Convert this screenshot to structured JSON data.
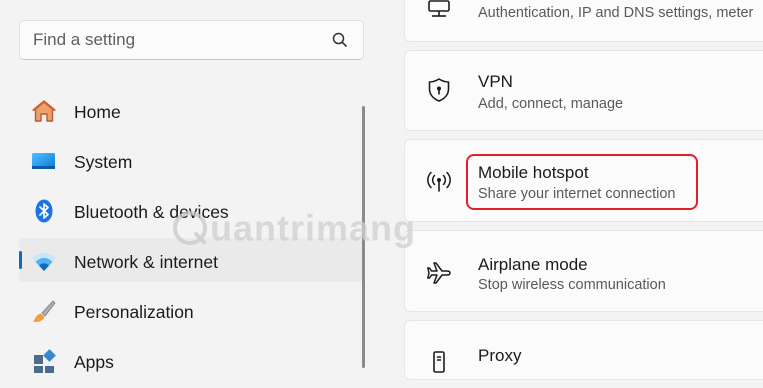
{
  "search": {
    "placeholder": "Find a setting",
    "icon": "search-icon"
  },
  "nav": {
    "items": [
      {
        "label": "Home",
        "icon": "home-icon",
        "selected": false
      },
      {
        "label": "System",
        "icon": "system-display-icon",
        "selected": false
      },
      {
        "label": "Bluetooth & devices",
        "icon": "bluetooth-icon",
        "selected": false
      },
      {
        "label": "Network & internet",
        "icon": "wifi-icon",
        "selected": true
      },
      {
        "label": "Personalization",
        "icon": "brush-icon",
        "selected": false
      },
      {
        "label": "Apps",
        "icon": "apps-icon",
        "selected": false
      }
    ]
  },
  "cards": [
    {
      "title": "",
      "subtitle": "Authentication, IP and DNS settings, meter",
      "icon": "ethernet-icon"
    },
    {
      "title": "VPN",
      "subtitle": "Add, connect, manage",
      "icon": "shield-icon"
    },
    {
      "title": "Mobile hotspot",
      "subtitle": "Share your internet connection",
      "icon": "hotspot-icon",
      "highlighted": true
    },
    {
      "title": "Airplane mode",
      "subtitle": "Stop wireless communication",
      "icon": "airplane-icon"
    },
    {
      "title": "Proxy",
      "subtitle": "",
      "icon": "proxy-icon"
    }
  ],
  "watermark": {
    "text": "uantrimang"
  },
  "colors": {
    "accent": "#0f6cbd",
    "highlight": "#e0212c",
    "background": "#f3f3f3",
    "card": "#fbfbfb"
  }
}
